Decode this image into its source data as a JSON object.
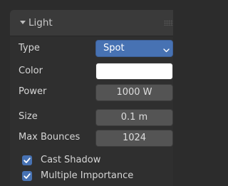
{
  "panel": {
    "title": "Light",
    "toggle_icon": "triangle-down-icon",
    "handle_icon": "drag-handle-icon"
  },
  "properties": {
    "type": {
      "label": "Type",
      "value": "Spot",
      "chevron_icon": "chevron-down-icon"
    },
    "color": {
      "label": "Color",
      "swatch": "#ffffff"
    },
    "power": {
      "label": "Power",
      "value": "1000 W"
    },
    "size": {
      "label": "Size",
      "value": "0.1 m"
    },
    "max_bounces": {
      "label": "Max Bounces",
      "value": "1024"
    }
  },
  "options": {
    "cast_shadow": {
      "label": "Cast Shadow",
      "checked": true,
      "check_icon": "checkmark-icon"
    },
    "multiple_importance": {
      "label": "Multiple Importance",
      "checked": true,
      "check_icon": "checkmark-icon"
    }
  },
  "colors": {
    "background": "#2c2c2c",
    "panel_body": "#2f2f2f",
    "panel_header": "#3a3a3a",
    "field": "#545454",
    "accent": "#4772b3",
    "text": "#d6d6d6"
  }
}
